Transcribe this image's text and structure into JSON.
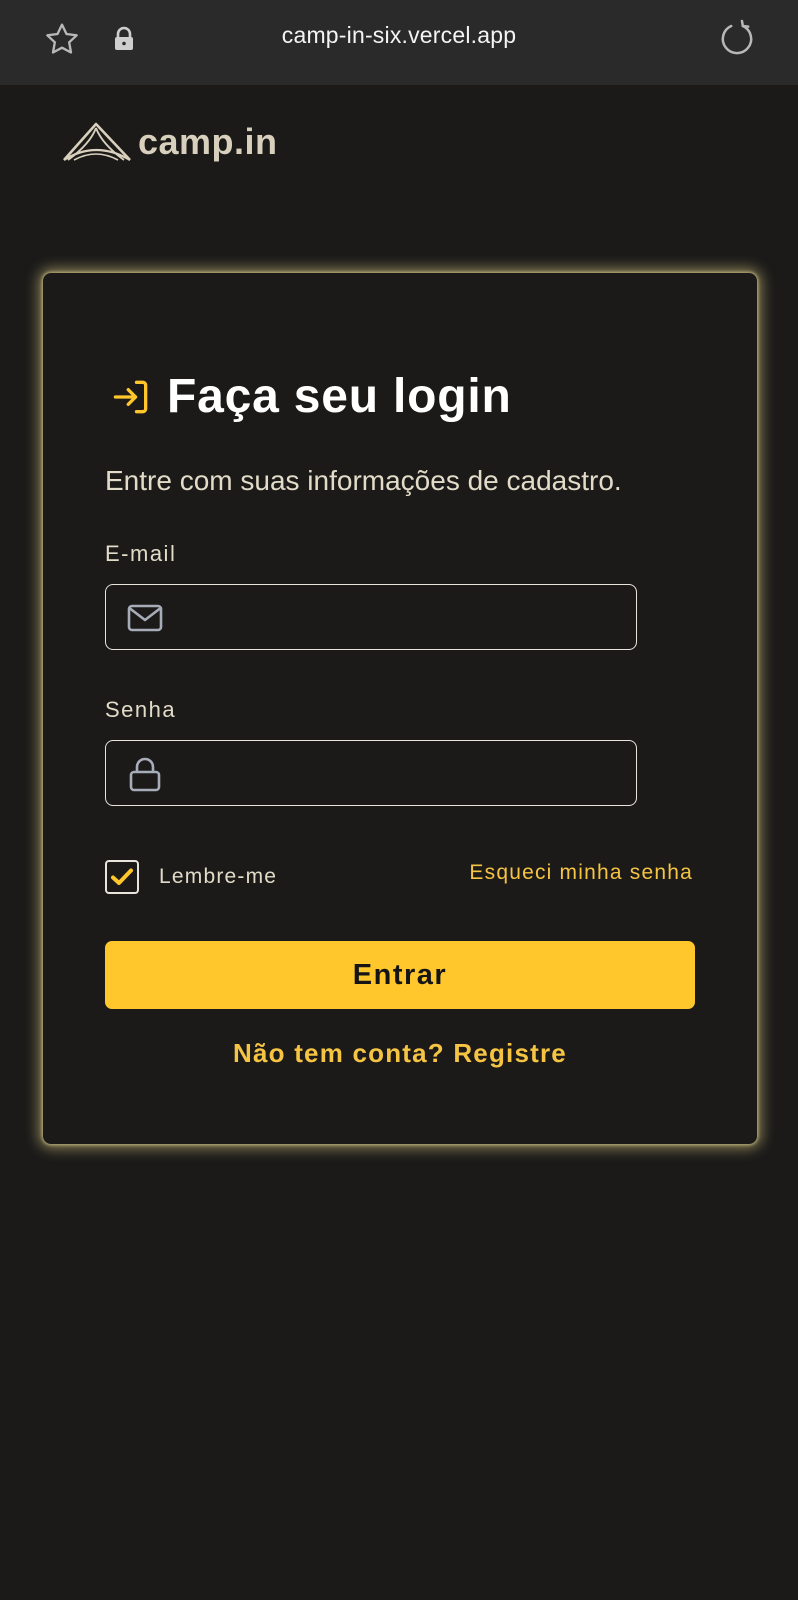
{
  "browser": {
    "url": "camp-in-six.vercel.app"
  },
  "logo": {
    "text": "camp.in"
  },
  "login": {
    "title": "Faça seu login",
    "subtitle": "Entre com suas informações de cadastro.",
    "email_label": "E-mail",
    "email_value": "",
    "password_label": "Senha",
    "password_value": "",
    "remember_label": "Lembre-me",
    "remember_checked": true,
    "forgot_link": "Esqueci minha senha",
    "submit_label": "Entrar",
    "register_prompt": "Não tem conta?",
    "register_link": "Registre"
  },
  "colors": {
    "background": "#1b1a19",
    "accent": "#ffc72c",
    "link": "#f6c443",
    "text_muted": "#e2dbc8",
    "card_glow": "#ecdc8c"
  },
  "icons": {
    "browser_bar": [
      "star-icon",
      "lock-icon",
      "reload-icon"
    ],
    "title": "login-arrow-icon",
    "email": "mail-icon",
    "password": "padlock-icon",
    "checkbox": "checkmark-icon"
  }
}
